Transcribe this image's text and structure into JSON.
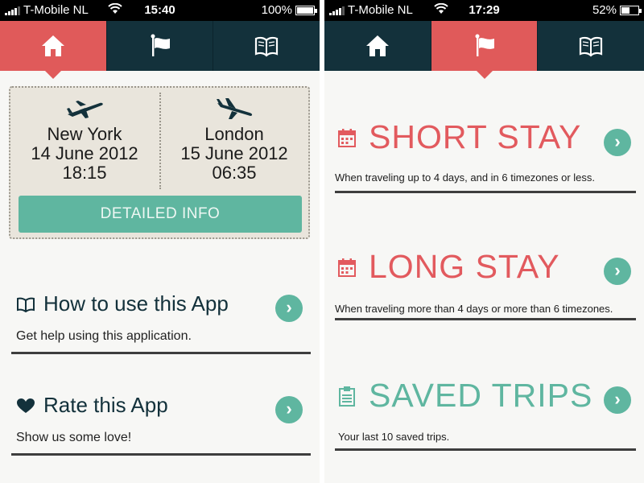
{
  "left": {
    "status": {
      "carrier": "T-Mobile NL",
      "time": "15:40",
      "battery": "100%",
      "battery_level": 1.0
    },
    "tabs": [
      {
        "icon": "home-icon",
        "active": true
      },
      {
        "icon": "flag-icon",
        "active": false
      },
      {
        "icon": "book-icon",
        "active": false
      }
    ],
    "flight": {
      "departure": {
        "city": "New York",
        "date": "14 June 2012",
        "time": "18:15"
      },
      "arrival": {
        "city": "London",
        "date": "15 June 2012",
        "time": "06:35"
      },
      "detail_button": "DETAILED INFO"
    },
    "menu": [
      {
        "icon": "open-book-icon",
        "title": "How to use this App",
        "subtitle": "Get help using this application."
      },
      {
        "icon": "heart-icon",
        "title": "Rate this App",
        "subtitle": "Show us some love!"
      }
    ]
  },
  "right": {
    "status": {
      "carrier": "T-Mobile NL",
      "time": "17:29",
      "battery": "52%",
      "battery_level": 0.52
    },
    "tabs": [
      {
        "icon": "home-icon",
        "active": false
      },
      {
        "icon": "flag-icon",
        "active": true
      },
      {
        "icon": "book-icon",
        "active": false
      }
    ],
    "items": [
      {
        "icon": "calendar-icon",
        "title": "SHORT STAY",
        "description": "When traveling up to 4 days, and in 6 timezones or less.",
        "color": "#e25a5e"
      },
      {
        "icon": "calendar-icon",
        "title": "LONG STAY",
        "description": "When traveling more than 4 days or more than 6 timezones.",
        "color": "#e25a5e"
      },
      {
        "icon": "clipboard-icon",
        "title": "SAVED TRIPS",
        "description": "Your last 10 saved trips.",
        "color": "#5fb6a0"
      }
    ]
  },
  "colors": {
    "accent_red": "#e05a5a",
    "teal": "#5fb6a0",
    "navy": "#13313b",
    "card": "#e9e5dc"
  }
}
